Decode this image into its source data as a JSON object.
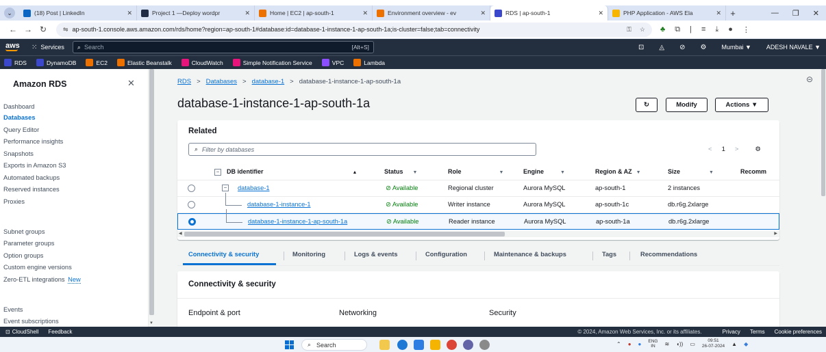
{
  "browser": {
    "tabs": [
      {
        "label": "(18) Post | LinkedIn",
        "icon": "linkedin-icon",
        "color": "#0a66c2",
        "active": false
      },
      {
        "label": "Project 1 —Deploy wordpr",
        "icon": "project-icon",
        "color": "#1f2a44",
        "active": false
      },
      {
        "label": "Home | EC2 | ap-south-1",
        "icon": "ec2-icon",
        "color": "#ed7100",
        "active": false
      },
      {
        "label": "Environment overview - ev",
        "icon": "beanstalk-icon",
        "color": "#ed7100",
        "active": false
      },
      {
        "label": "RDS | ap-south-1",
        "icon": "rds-icon",
        "color": "#3b48cc",
        "active": true
      },
      {
        "label": "PHP Application - AWS Ela",
        "icon": "php-icon",
        "color": "#f7b500",
        "active": false
      }
    ],
    "url": "ap-south-1.console.aws.amazon.com/rds/home?region=ap-south-1#database:id=database-1-instance-1-ap-south-1a;is-cluster=false;tab=connectivity"
  },
  "aws_header": {
    "logo": "aws",
    "services_label": "Services",
    "search_placeholder": "Search",
    "search_shortcut": "[Alt+S]",
    "region": "Mumbai ▼",
    "user": "ADESH NAVALE ▼"
  },
  "favorites": [
    {
      "label": "RDS",
      "color": "#3b48cc"
    },
    {
      "label": "DynamoDB",
      "color": "#3b48cc"
    },
    {
      "label": "EC2",
      "color": "#ed7100"
    },
    {
      "label": "Elastic Beanstalk",
      "color": "#ed7100"
    },
    {
      "label": "CloudWatch",
      "color": "#e7157b"
    },
    {
      "label": "Simple Notification Service",
      "color": "#e7157b"
    },
    {
      "label": "VPC",
      "color": "#8c4fff"
    },
    {
      "label": "Lambda",
      "color": "#ed7100"
    }
  ],
  "sidebar": {
    "title": "Amazon RDS",
    "items": [
      {
        "label": "Dashboard",
        "active": false
      },
      {
        "label": "Databases",
        "active": true
      },
      {
        "label": "Query Editor",
        "active": false
      },
      {
        "label": "Performance insights",
        "active": false
      },
      {
        "label": "Snapshots",
        "active": false
      },
      {
        "label": "Exports in Amazon S3",
        "active": false
      },
      {
        "label": "Automated backups",
        "active": false
      },
      {
        "label": "Reserved instances",
        "active": false
      },
      {
        "label": "Proxies",
        "active": false
      },
      {
        "label": "Subnet groups",
        "active": false
      },
      {
        "label": "Parameter groups",
        "active": false
      },
      {
        "label": "Option groups",
        "active": false
      },
      {
        "label": "Custom engine versions",
        "active": false
      },
      {
        "label": "Zero-ETL integrations",
        "badge": "New",
        "active": false
      },
      {
        "label": "Events",
        "active": false
      },
      {
        "label": "Event subscriptions",
        "active": false
      }
    ]
  },
  "breadcrumb": {
    "items": [
      "RDS",
      "Databases",
      "database-1",
      "database-1-instance-1-ap-south-1a"
    ],
    "separator": ">"
  },
  "page": {
    "title": "database-1-instance-1-ap-south-1a",
    "refresh_icon": "refresh-icon",
    "modify_label": "Modify",
    "actions_label": "Actions ▼"
  },
  "related": {
    "title": "Related",
    "filter_placeholder": "Filter by databases",
    "page_number": "1",
    "columns": [
      "DB identifier",
      "Status",
      "Role",
      "Engine",
      "Region & AZ",
      "Size",
      "Recomm"
    ],
    "rows": [
      {
        "id": "database-1",
        "status": "Available",
        "role": "Regional cluster",
        "engine": "Aurora MySQL",
        "region": "ap-south-1",
        "size": "2 instances",
        "selected": false
      },
      {
        "id": "database-1-instance-1",
        "status": "Available",
        "role": "Writer instance",
        "engine": "Aurora MySQL",
        "region": "ap-south-1c",
        "size": "db.r6g.2xlarge",
        "selected": false
      },
      {
        "id": "database-1-instance-1-ap-south-1a",
        "status": "Available",
        "role": "Reader instance",
        "engine": "Aurora MySQL",
        "region": "ap-south-1a",
        "size": "db.r6g.2xlarge",
        "selected": true
      }
    ]
  },
  "detail_tabs": [
    {
      "label": "Connectivity & security",
      "active": true
    },
    {
      "label": "Monitoring",
      "active": false
    },
    {
      "label": "Logs & events",
      "active": false
    },
    {
      "label": "Configuration",
      "active": false
    },
    {
      "label": "Maintenance & backups",
      "active": false
    },
    {
      "label": "Tags",
      "active": false
    },
    {
      "label": "Recommendations",
      "active": false
    }
  ],
  "connectivity": {
    "title": "Connectivity & security",
    "columns": [
      "Endpoint & port",
      "Networking",
      "Security"
    ]
  },
  "footer": {
    "cloudshell": "CloudShell",
    "feedback": "Feedback",
    "copyright": "© 2024, Amazon Web Services, Inc. or its affiliates.",
    "links": [
      "Privacy",
      "Terms",
      "Cookie preferences"
    ]
  },
  "taskbar": {
    "search_label": "Search",
    "lang_top": "ENG",
    "lang_bottom": "IN",
    "time": "09:51",
    "date": "26-07-2024"
  }
}
